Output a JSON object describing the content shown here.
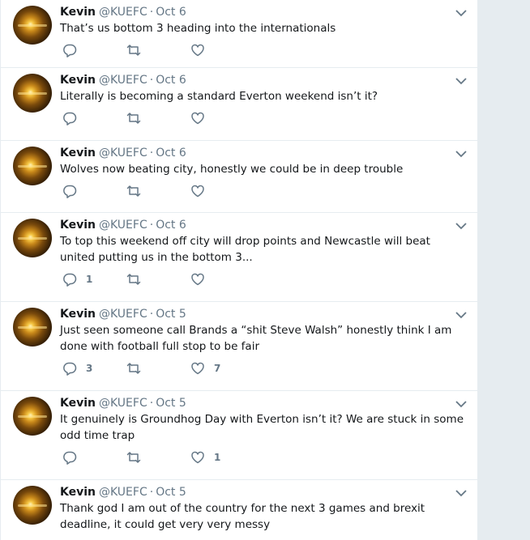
{
  "timeline": {
    "tweets": [
      {
        "name": "Kevin",
        "handle": "@KUEFC",
        "dot": "·",
        "time": "Oct 6",
        "text": "That’s us bottom 3 heading into the internationals",
        "replies": "",
        "retweets": "",
        "likes": ""
      },
      {
        "name": "Kevin",
        "handle": "@KUEFC",
        "dot": "·",
        "time": "Oct 6",
        "text": "Literally is becoming a standard Everton weekend isn’t it?",
        "replies": "",
        "retweets": "",
        "likes": ""
      },
      {
        "name": "Kevin",
        "handle": "@KUEFC",
        "dot": "·",
        "time": "Oct 6",
        "text": "Wolves now beating city, honestly we could be in deep trouble",
        "replies": "",
        "retweets": "",
        "likes": ""
      },
      {
        "name": "Kevin",
        "handle": "@KUEFC",
        "dot": "·",
        "time": "Oct 6",
        "text": "To top this weekend off city will drop points and Newcastle will beat united putting us in the bottom 3...",
        "replies": "1",
        "retweets": "",
        "likes": ""
      },
      {
        "name": "Kevin",
        "handle": "@KUEFC",
        "dot": "·",
        "time": "Oct 5",
        "text": "Just seen someone call Brands a “shit Steve Walsh” honestly think I am done with football full stop to be fair",
        "replies": "3",
        "retweets": "",
        "likes": "7"
      },
      {
        "name": "Kevin",
        "handle": "@KUEFC",
        "dot": "·",
        "time": "Oct 5",
        "text": "It genuinely is Groundhog Day with Everton isn’t it? We are stuck in some odd time trap",
        "replies": "",
        "retweets": "",
        "likes": "1"
      },
      {
        "name": "Kevin",
        "handle": "@KUEFC",
        "dot": "·",
        "time": "Oct 5",
        "text": "Thank god I am out of the country for the next 3 games and brexit deadline, it could get very very messy",
        "replies": "",
        "retweets": "",
        "likes": ""
      }
    ]
  },
  "icons": {
    "reply": "reply-icon",
    "retweet": "retweet-icon",
    "like": "like-icon",
    "menu": "chevron-down-icon"
  },
  "colors": {
    "background": "#e6ecf0",
    "card": "#ffffff",
    "text": "#14171a",
    "muted": "#657786"
  }
}
